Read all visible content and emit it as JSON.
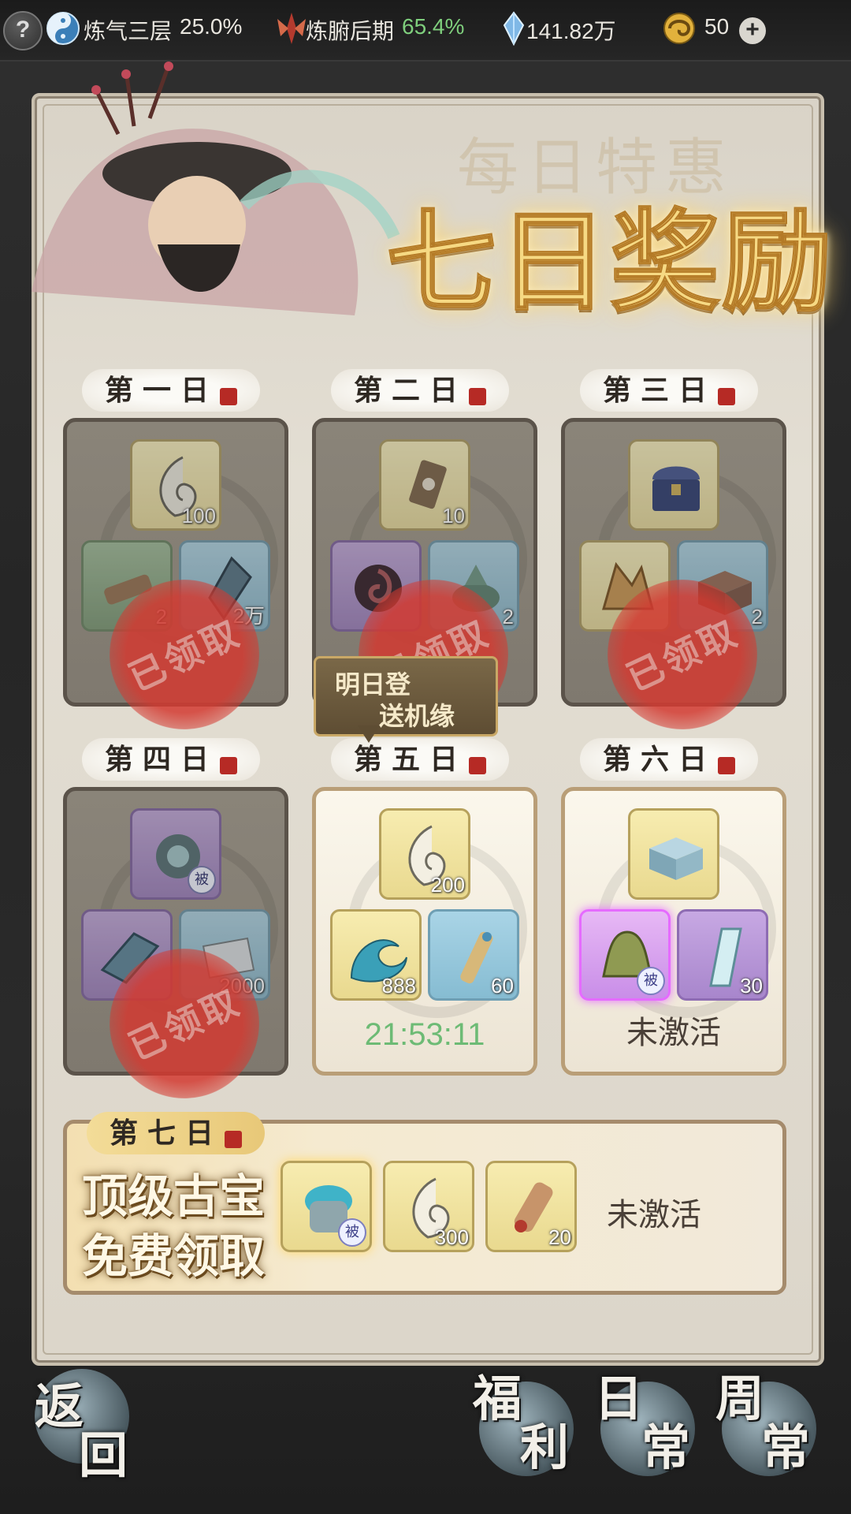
{
  "topbar": {
    "realm_label": "炼气三层",
    "realm_percent": "25.0%",
    "body_label": "炼腑后期",
    "body_percent": "65.4%",
    "spirit_stones": "141.82万",
    "currency_amount": "50",
    "help_symbol": "?",
    "plus_symbol": "+"
  },
  "banner": {
    "title": "七日奖励",
    "ghost_title": "每日特惠"
  },
  "days": [
    {
      "label": "第一日",
      "state": "claimed",
      "items": [
        {
          "icon": "jade-crescent-icon",
          "qty": "100"
        },
        {
          "icon": "scroll-icon",
          "qty": "2"
        },
        {
          "icon": "crystal-icon",
          "qty": "2万"
        }
      ]
    },
    {
      "label": "第二日",
      "state": "claimed",
      "items": [
        {
          "icon": "talisman-icon",
          "qty": "10"
        },
        {
          "icon": "swirl-orb-icon",
          "qty": ""
        },
        {
          "icon": "incense-burner-icon",
          "qty": "2"
        }
      ]
    },
    {
      "label": "第三日",
      "state": "claimed",
      "items": [
        {
          "icon": "treasure-chest-icon",
          "qty": ""
        },
        {
          "icon": "ore-icon",
          "qty": ""
        },
        {
          "icon": "box-icon",
          "qty": "2"
        }
      ]
    },
    {
      "label": "第四日",
      "state": "claimed",
      "items": [
        {
          "icon": "artifact-icon",
          "badge": "被"
        },
        {
          "icon": "crystal-shard-icon",
          "qty": ""
        },
        {
          "icon": "paper-icon",
          "qty": "2000"
        }
      ]
    },
    {
      "label": "第五日",
      "state": "active",
      "timer": "21:53:11",
      "items": [
        {
          "icon": "jade-crescent-icon",
          "qty": "200"
        },
        {
          "icon": "wave-icon",
          "qty": "888"
        },
        {
          "icon": "scroll-tube-icon",
          "qty": "60"
        }
      ]
    },
    {
      "label": "第六日",
      "state": "inactive",
      "status": "未激活",
      "items": [
        {
          "icon": "ice-box-icon",
          "qty": ""
        },
        {
          "icon": "bell-icon",
          "badge": "被"
        },
        {
          "icon": "sword-scroll-icon",
          "qty": "30"
        }
      ]
    }
  ],
  "stamp_text": "已领取",
  "tooltip": {
    "line1": "明日登",
    "line2": "送机缘"
  },
  "day7": {
    "label": "第七日",
    "promo_line1": "顶级古宝",
    "promo_line2": "免费领取",
    "status": "未激活",
    "items": [
      {
        "icon": "jade-ring-icon",
        "badge": "被"
      },
      {
        "icon": "jade-crescent-icon",
        "qty": "300"
      },
      {
        "icon": "talisman-scroll-icon",
        "qty": "20"
      }
    ]
  },
  "bottom": {
    "back": {
      "line1": "返",
      "line2": "回"
    },
    "welfare": {
      "line1": "福",
      "line2": "利"
    },
    "daily": {
      "line1": "日",
      "line2": "常"
    },
    "weekly": {
      "line1": "周",
      "line2": "常"
    }
  },
  "colors": {
    "timer": "#6dbb75",
    "title_gold": "#f6d983",
    "stamp_red": "#d33a31",
    "green_percent": "#7fcf7d"
  }
}
